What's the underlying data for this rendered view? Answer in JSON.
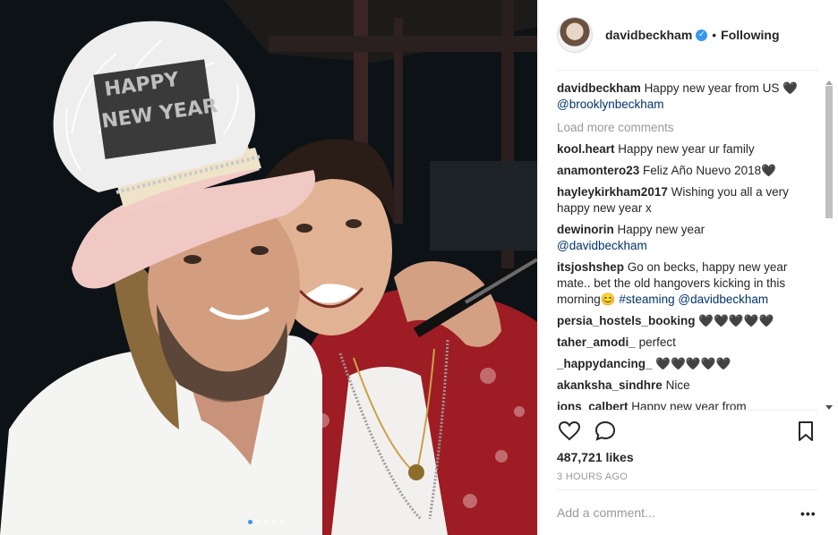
{
  "photo": {
    "hat_text_top": "HAPPY",
    "hat_text_bottom": "NEW YEAR",
    "carousel_dots": 5,
    "active_dot": 0
  },
  "header": {
    "username": "davidbeckham",
    "verified_icon": "verified-check-icon",
    "separator": "•",
    "follow_label": "Following"
  },
  "caption": {
    "user": "davidbeckham",
    "text": "Happy new year from US 🖤",
    "mention": "@brooklynbeckham"
  },
  "load_more": "Load more comments",
  "comments": [
    {
      "user": "kool.heart",
      "text": "Happy new year ur family",
      "link": ""
    },
    {
      "user": "anamontero23",
      "text": "Feliz Año Nuevo 2018🖤",
      "link": ""
    },
    {
      "user": "hayleykirkham2017",
      "text": "Wishing you all a very happy new year x",
      "link": ""
    },
    {
      "user": "dewinorin",
      "text": "Happy new year",
      "link": "@davidbeckham"
    },
    {
      "user": "itsjoshshep",
      "text": "Go on becks, happy new year mate.. bet the old hangovers kicking in this morning😊",
      "link": "#steaming @davidbeckham"
    },
    {
      "user": "persia_hostels_booking",
      "text": "🖤🖤🖤🖤🖤",
      "link": ""
    },
    {
      "user": "taher_amodi_",
      "text": "perfect",
      "link": ""
    },
    {
      "user": "_happydancing_",
      "text": "🖤🖤🖤🖤🖤",
      "link": ""
    },
    {
      "user": "akanksha_sindhre",
      "text": "Nice",
      "link": ""
    },
    {
      "user": "jons_calbert",
      "text": "Happy new year from",
      "link": ""
    }
  ],
  "actions": {
    "like_icon": "heart-icon",
    "comment_icon": "comment-bubble-icon",
    "save_icon": "bookmark-icon"
  },
  "likes": "487,721 likes",
  "timestamp": "3 HOURS AGO",
  "add_comment_placeholder": "Add a comment...",
  "more_options": "•••",
  "colors": {
    "text": "#262626",
    "link": "#003569",
    "muted": "#999999",
    "verified": "#3897f0",
    "border": "#efefef"
  }
}
